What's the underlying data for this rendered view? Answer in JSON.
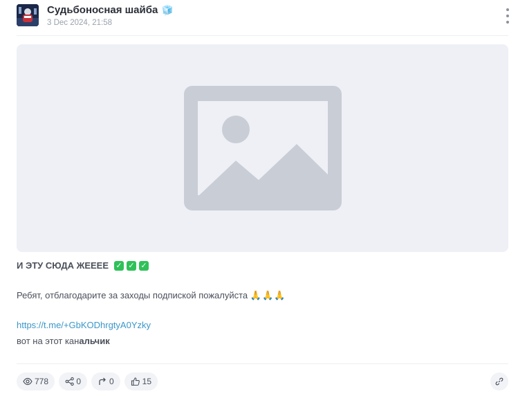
{
  "post": {
    "channel_name": "Судьбоносная шайба",
    "channel_emoji": "🧊",
    "date": "3 Dec 2024, 21:58",
    "headline": "И ЭТУ СЮДА ЖЕЕЕЕ",
    "headline_marks": [
      "✓",
      "✓",
      "✓"
    ],
    "body_line": "Ребят, отблагодарите за заходы подпиской пожалуйста",
    "body_emojis": "🙏🙏🙏",
    "link": "https://t.me/+GbKODhrgtyA0Yzky",
    "last_line_prefix": "вот на этот кан",
    "last_line_bold": "альчик"
  },
  "stats": {
    "views": "778",
    "shares": "0",
    "forwards": "0",
    "reactions": "15"
  },
  "icons": {
    "menu": "more-vertical-icon",
    "image_placeholder": "image-placeholder-icon",
    "views": "eye-icon",
    "shares": "share-icon",
    "forwards": "forward-arrow-icon",
    "reactions": "thumbs-up-icon",
    "link": "link-icon"
  },
  "colors": {
    "link": "#3a97c9",
    "check_badge": "#2fc159",
    "placeholder_bg": "#eef0f6",
    "placeholder_icon": "#c9cdd6"
  }
}
